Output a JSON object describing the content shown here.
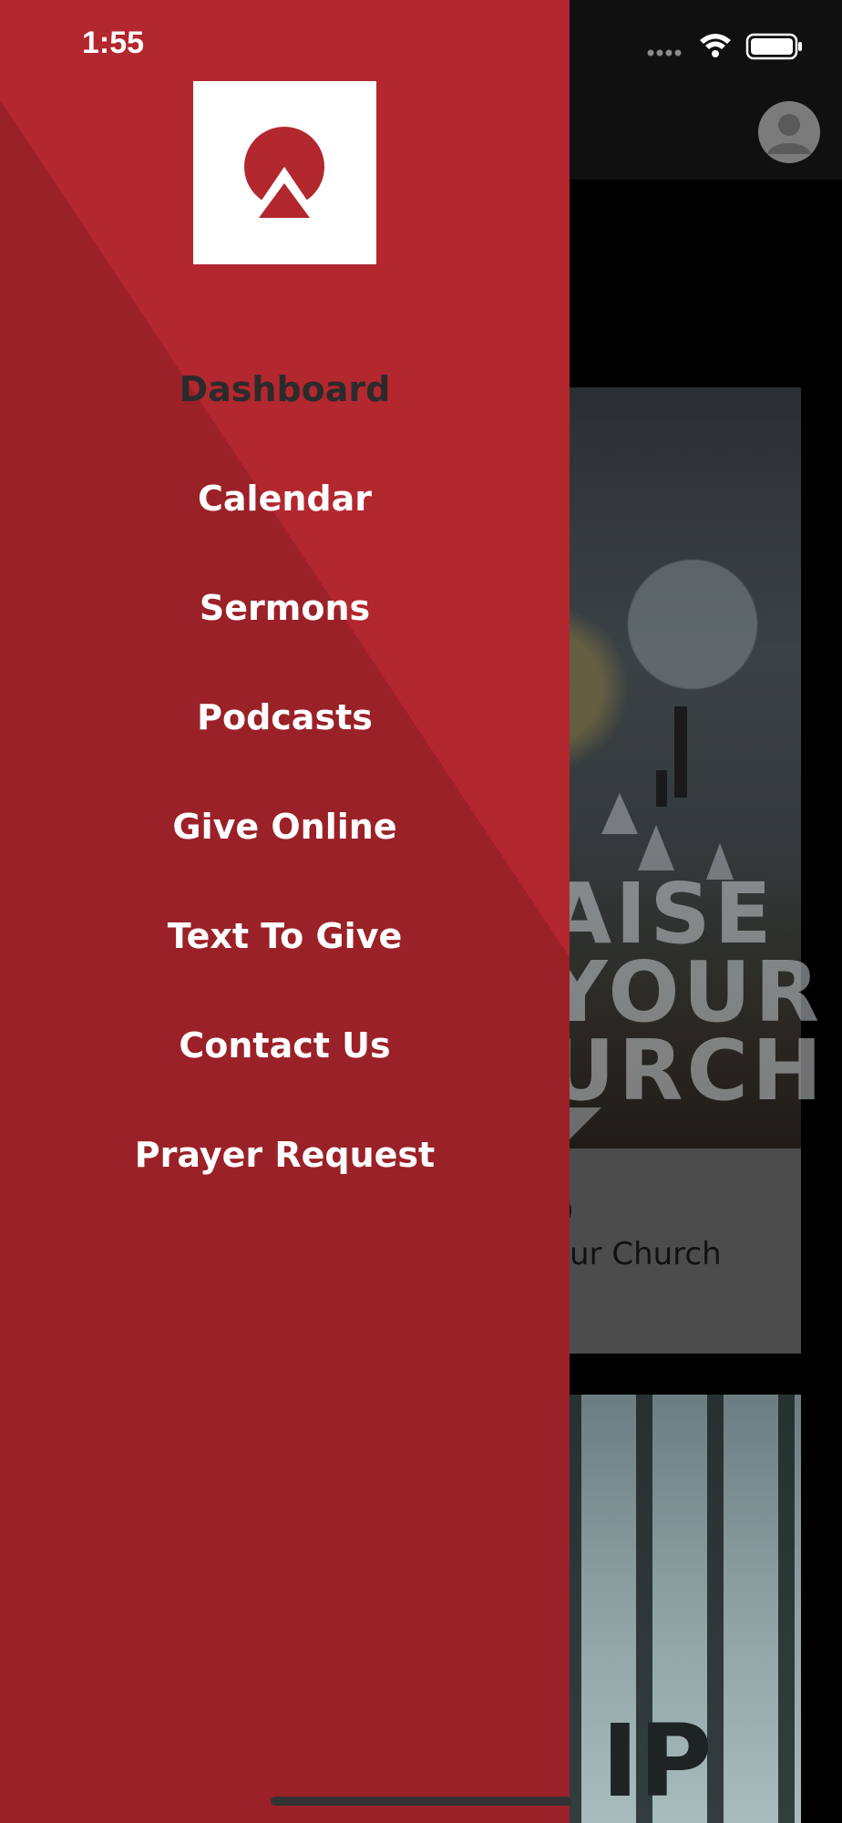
{
  "status_bar": {
    "time": "1:55"
  },
  "header": {
    "avatar_icon": "user-avatar-icon"
  },
  "background_content": {
    "card1": {
      "image_text_lines": [
        "AISE",
        "YOUR",
        "URCH"
      ],
      "caption_title": "ip",
      "caption_subtitle": "ur Church"
    },
    "card2": {
      "image_text": "IP"
    }
  },
  "drawer": {
    "logo_icon": "church-logo-icon",
    "accent_color": "#b3272f",
    "base_color": "#9b2128",
    "menu_items": [
      {
        "label": "Dashboard",
        "active": true
      },
      {
        "label": "Calendar",
        "active": false
      },
      {
        "label": "Sermons",
        "active": false
      },
      {
        "label": "Podcasts",
        "active": false
      },
      {
        "label": "Give Online",
        "active": false
      },
      {
        "label": "Text To Give",
        "active": false
      },
      {
        "label": "Contact Us",
        "active": false
      },
      {
        "label": "Prayer Request",
        "active": false
      }
    ]
  }
}
